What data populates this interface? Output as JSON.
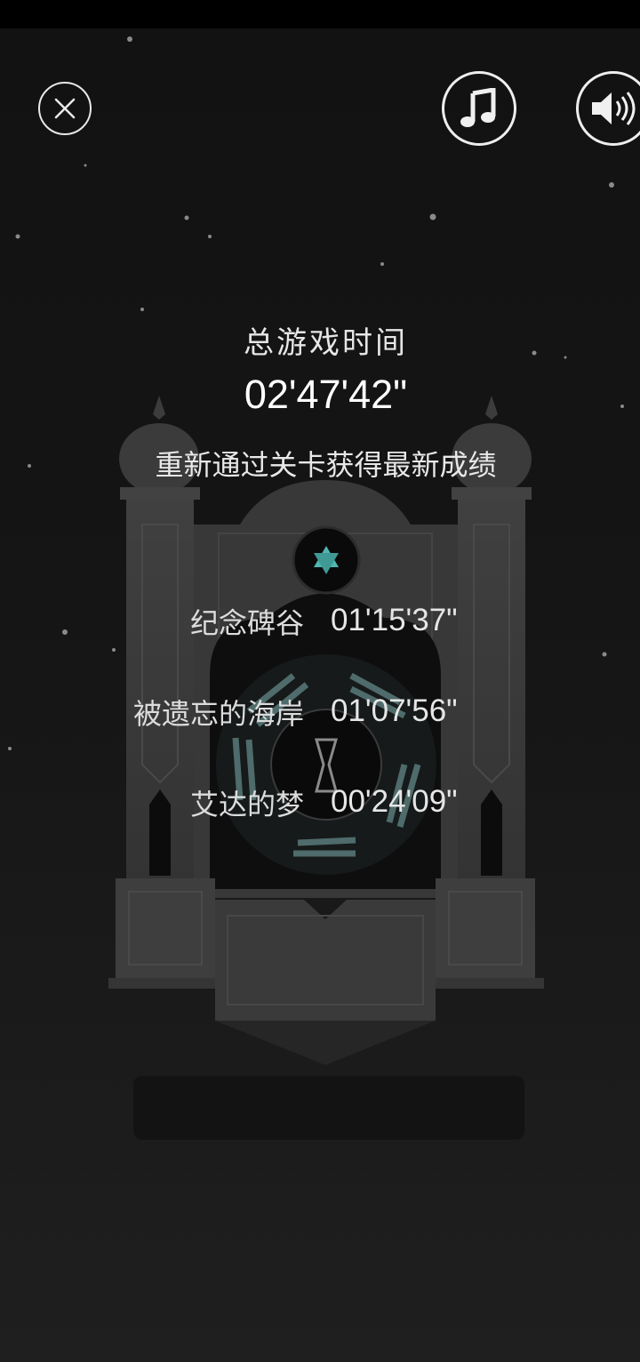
{
  "header": {
    "close_icon": "close-icon",
    "music_icon": "music-note-icon",
    "sound_icon": "speaker-icon"
  },
  "summary": {
    "total_label": "总游戏时间",
    "total_time": "02'47'42\"",
    "replay_hint": "重新通过关卡获得最新成绩"
  },
  "levels": [
    {
      "name": "纪念碑谷",
      "time": "01'15'37\""
    },
    {
      "name": "被遗忘的海岸",
      "time": "01'07'56\""
    },
    {
      "name": "艾达的梦",
      "time": "00'24'09\""
    }
  ],
  "colors": {
    "background": "#141414",
    "monument": "#3a3a3a",
    "accent": "#4fb6b0",
    "text": "#f2f2f2"
  }
}
